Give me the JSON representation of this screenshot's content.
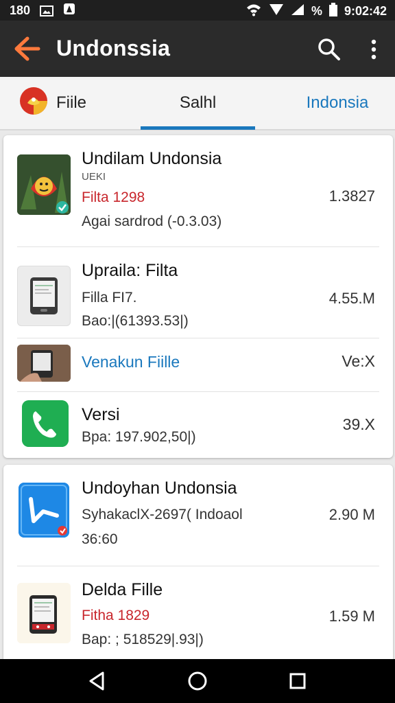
{
  "status": {
    "left_icons": [
      "180",
      "picture-icon",
      "triangle-a-icon"
    ],
    "time": "9:02:42",
    "battery": "%"
  },
  "app": {
    "title": "Undonssia"
  },
  "tabs": [
    {
      "label": "Fiile",
      "icon": "flag-logo-icon"
    },
    {
      "label": "Salhl"
    },
    {
      "label": "Indonsia"
    }
  ],
  "colors": {
    "accent": "#1a78bd",
    "red": "#c8262c",
    "green": "#129a52",
    "appbar": "#2b2b2b"
  },
  "list1": [
    {
      "title": "Undilam Undonsia",
      "tag": "UEKI",
      "sub1": "Filta 1298",
      "sub2": "Agai sardrod (-0.3.03)",
      "right": "1.3827"
    },
    {
      "title": "Upraila: Filta",
      "sub1": "Filla FI7.",
      "sub2": "Bao:|(61393.53|)",
      "right": "4.55.M"
    },
    {
      "title": "Venakun Fiille",
      "right": "Ve:X"
    },
    {
      "title": "Versi",
      "sub1": "Bpa: 197.902,50|)",
      "right": "39.X"
    }
  ],
  "list2": [
    {
      "title": "Undoyhan Undonsia",
      "sub1": "SyhakaclX-2697( Indoaol",
      "sub2": "36:60",
      "right": "2.90 M"
    },
    {
      "title": "Delda Fille",
      "sub1": "Fitha 1829",
      "sub2": "Bap: ; 518529|.93|)",
      "right": "1.59 M"
    }
  ]
}
